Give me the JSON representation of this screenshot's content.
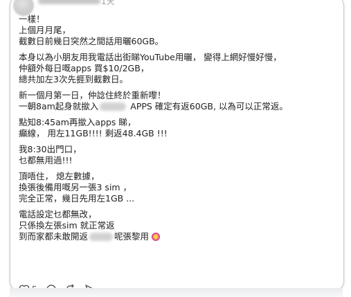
{
  "post": {
    "timestamp": "1天",
    "paragraphs": [
      [
        "一樣！",
        "上個月月尾，",
        "截數日前幾日突然之間話用曬60GB。"
      ],
      [
        "本身以為小朋友用我電話出街睇YouTube用曬， 變得上網好慢好慢，",
        "仲額外每日嘅apps 買$10/2GB，",
        "總共加左3次先捱到截數日。"
      ],
      [
        "新一個月第一日，仲諗住終於重新嚟！"
      ],
      [
        "點知8:45am再撳入apps 睇，",
        "癲線， 用左11GB!!!! 剩返48.4GB !!!"
      ],
      [
        "我8:30出門口，",
        "乜都無用過!!!"
      ],
      [
        "頂唔住， 熄左數據，",
        "換張後備用嘅另一張3 sim ，",
        "完全正常，幾日先用左1GB ..."
      ],
      [
        "電話設定乜都無改，",
        "只係換左張sim 就正常返"
      ]
    ],
    "apps_line": {
      "before": "一朝8am起身就撳入",
      "after": " APPS 確定有返60GB, 以為可以正常返。"
    },
    "last_line": {
      "before": "到而家都未敢開返",
      "after": "呢張黎用"
    },
    "like_count": "5"
  },
  "icons": {
    "like": "heart-icon",
    "comment": "comment-icon",
    "repost": "repost-icon",
    "share": "share-icon",
    "emoji": "grimace-emoji-icon"
  },
  "colors": {
    "text": "#222222",
    "muted": "#9aa0a6",
    "border": "#c9ccd1"
  }
}
